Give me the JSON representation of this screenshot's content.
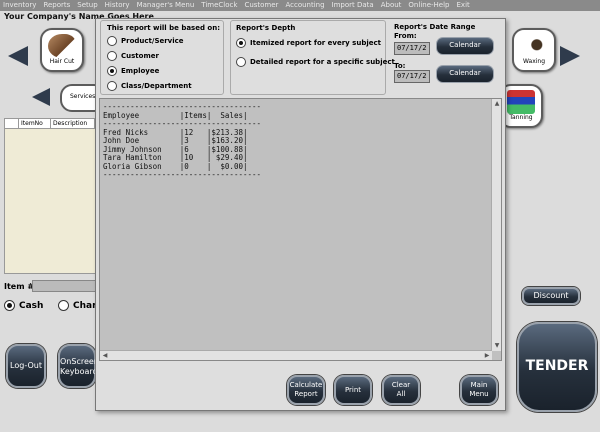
{
  "menubar": [
    "Inventory",
    "Reports",
    "Setup",
    "History",
    "Manager's Menu",
    "TimeClock",
    "Customer",
    "Accounting",
    "Import Data",
    "About",
    "Online-Help",
    "Exit"
  ],
  "company_name": "Your Company's Name Goes Here",
  "categories": {
    "haircut": "Hair Cut",
    "services": "Services",
    "waxing": "Waxing",
    "tanning": "Tanning"
  },
  "items_table": {
    "headers": [
      "",
      "ItemNo",
      "Description"
    ]
  },
  "item_label": "Item #",
  "payment": {
    "cash": "Cash",
    "charge": "Char",
    "selected": "cash"
  },
  "buttons": {
    "logout": "Log-Out",
    "keyboard": "OnScreen\nKeyboard",
    "discount": "Discount",
    "tender": "TENDER"
  },
  "report_dialog": {
    "basis": {
      "title": "This report will be based on:",
      "options": [
        "Product/Service",
        "Customer",
        "Employee",
        "Class/Department"
      ],
      "selected": "Employee"
    },
    "depth": {
      "title": "Report's Depth",
      "options": [
        "Itemized report for every subject",
        "Detailed report for a specific subject"
      ],
      "selected": "Itemized report for every subject"
    },
    "date_range": {
      "title": "Report's Date Range",
      "from_label": "From:",
      "from_value": "07/17/2",
      "to_label": "To:",
      "to_value": "07/17/2",
      "calendar_label": "Calendar"
    },
    "report_text": "-----------------------------------\nEmployee         |Items|  Sales|\n-----------------------------------\nFred Nicks       |12   |$213.38|\nJohn Doe         |3    |$163.20|\nJimmy Johnson    |6    |$100.88|\nTara Hamilton    |10   | $29.40|\nGloria Gibson    |0    |  $0.00|\n-----------------------------------",
    "actions": {
      "calculate": "Calculate\nReport",
      "print": "Print",
      "clear": "Clear\nAll",
      "main_menu": "Main\nMenu"
    }
  },
  "colors": {
    "button_dark": "#26303c",
    "arrow": "#2f3b4c",
    "report_bg": "#c0c0c0"
  }
}
